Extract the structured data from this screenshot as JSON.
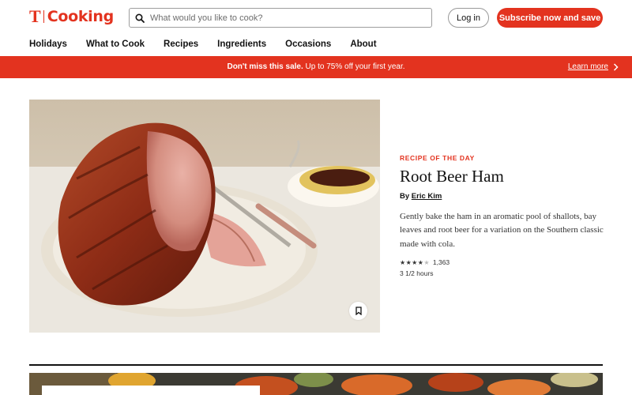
{
  "header": {
    "logo_t": "T",
    "logo_word": "Cooking",
    "search": {
      "placeholder": "What would you like to cook?"
    },
    "login_label": "Log in",
    "subscribe_label": "Subscribe now and save"
  },
  "nav": [
    "Holidays",
    "What to Cook",
    "Recipes",
    "Ingredients",
    "Occasions",
    "About"
  ],
  "promo": {
    "bold": "Don't miss this sale.",
    "text": " Up to 75% off your first year.",
    "link": "Learn more"
  },
  "hero": {
    "eyebrow": "RECIPE OF THE DAY",
    "title": "Root Beer Ham",
    "by": "By ",
    "author": "Eric Kim",
    "description": "Gently bake the ham in an aromatic pool of shallots, bay leaves and root beer for a variation on the Southern classic made with cola.",
    "rating_stars": 4,
    "rating_count": "1,363",
    "time": "3 1/2 hours"
  },
  "colors": {
    "brand": "#e3331f",
    "text": "#121212"
  },
  "icons": {
    "search": "search-icon",
    "bookmark": "bookmark-icon",
    "chevron": "chevron-right-icon"
  }
}
